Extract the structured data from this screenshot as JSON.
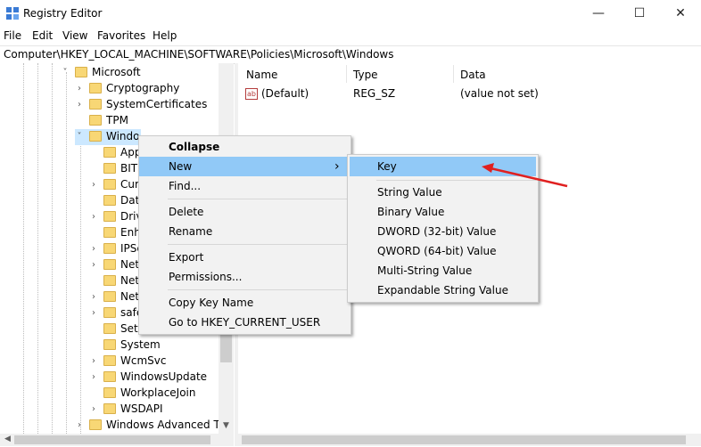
{
  "window": {
    "title": "Registry Editor",
    "minimize": "—",
    "maximize": "☐",
    "close": "✕"
  },
  "menubar": [
    "File",
    "Edit",
    "View",
    "Favorites",
    "Help"
  ],
  "address": "Computer\\HKEY_LOCAL_MACHINE\\SOFTWARE\\Policies\\Microsoft\\Windows",
  "tree": [
    {
      "label": "Microsoft",
      "chevron": "˅"
    },
    {
      "label": "Cryptography",
      "chevron": "›"
    },
    {
      "label": "SystemCertificates",
      "chevron": "›"
    },
    {
      "label": "TPM",
      "chevron": ""
    },
    {
      "label": "Windo",
      "chevron": "˅"
    },
    {
      "label": "App",
      "chevron": ""
    },
    {
      "label": "BITS",
      "chevron": ""
    },
    {
      "label": "Cur",
      "chevron": "›"
    },
    {
      "label": "Dat",
      "chevron": ""
    },
    {
      "label": "Driv",
      "chevron": "›"
    },
    {
      "label": "Enh",
      "chevron": ""
    },
    {
      "label": "IPSe",
      "chevron": "›"
    },
    {
      "label": "Net",
      "chevron": "›"
    },
    {
      "label": "Net",
      "chevron": ""
    },
    {
      "label": "Net",
      "chevron": "›"
    },
    {
      "label": "safe",
      "chevron": "›"
    },
    {
      "label": "Sett",
      "chevron": ""
    },
    {
      "label": "System",
      "chevron": ""
    },
    {
      "label": "WcmSvc",
      "chevron": "›"
    },
    {
      "label": "WindowsUpdate",
      "chevron": "›"
    },
    {
      "label": "WorkplaceJoin",
      "chevron": ""
    },
    {
      "label": "WSDAPI",
      "chevron": "›"
    },
    {
      "label": "Windows Advanced Thr",
      "chevron": "›"
    }
  ],
  "columns": {
    "name": "Name",
    "type": "Type",
    "data": "Data"
  },
  "values": [
    {
      "icon": "ab",
      "name": "(Default)",
      "type": "REG_SZ",
      "data": "(value not set)"
    }
  ],
  "context_menu": {
    "collapse": "Collapse",
    "new": "New",
    "new_arrow": "›",
    "find": "Find...",
    "delete": "Delete",
    "rename": "Rename",
    "export": "Export",
    "permissions": "Permissions...",
    "copy_key_name": "Copy Key Name",
    "goto_hkcu": "Go to HKEY_CURRENT_USER"
  },
  "submenu": {
    "key": "Key",
    "string": "String Value",
    "binary": "Binary Value",
    "dword": "DWORD (32-bit) Value",
    "qword": "QWORD (64-bit) Value",
    "multistring": "Multi-String Value",
    "expandable": "Expandable String Value"
  },
  "colors": {
    "highlight": "#91c9f7",
    "folder": "#f8d775",
    "annotation_arrow": "#e02020"
  }
}
